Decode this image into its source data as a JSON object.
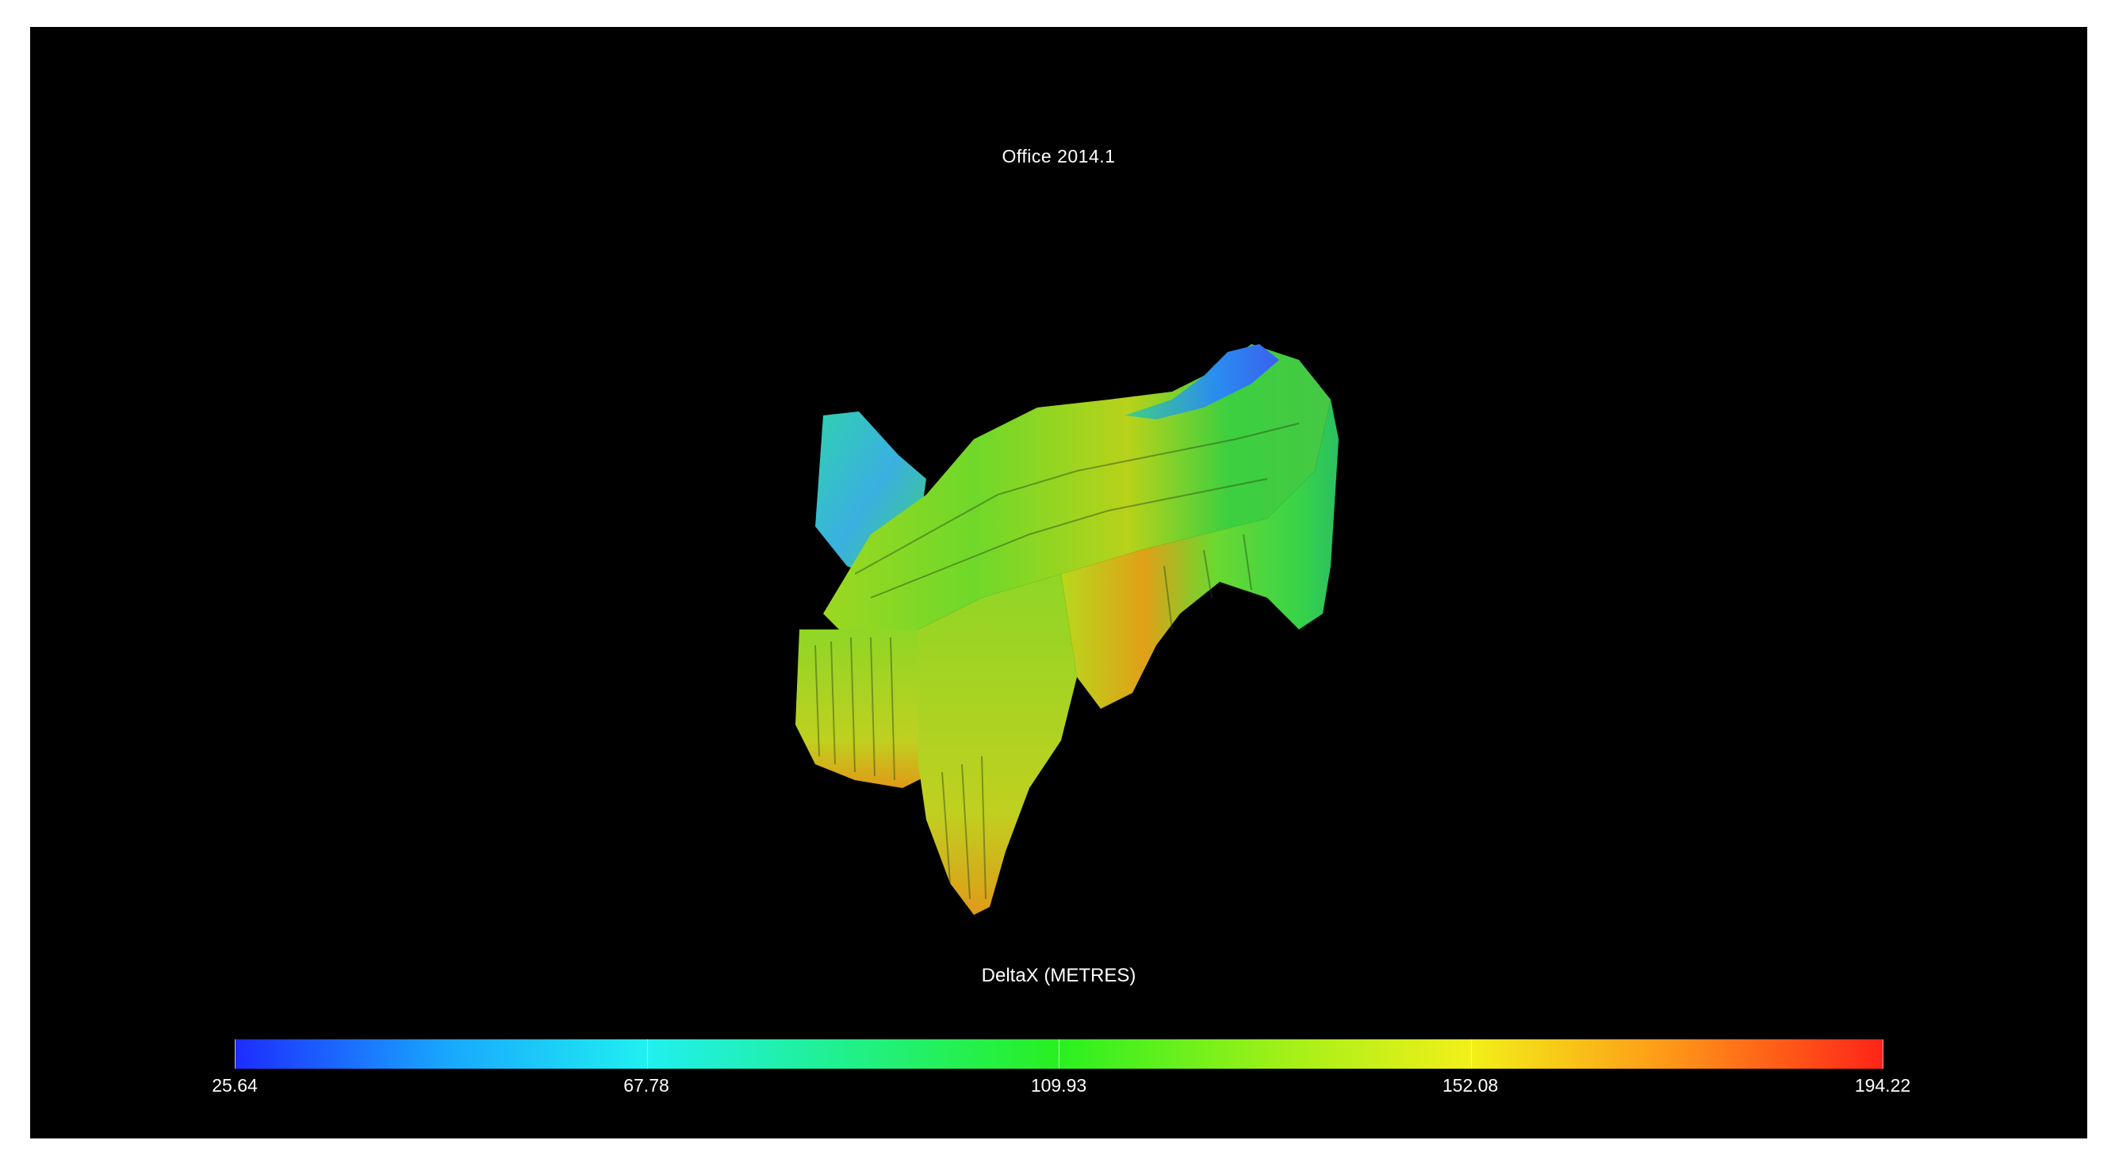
{
  "viewer": {
    "title": "Office 2014.1",
    "property_label": "DeltaX (METRES)"
  },
  "colorbar": {
    "ticks": [
      "25.64",
      "67.78",
      "109.93",
      "152.08",
      "194.22"
    ],
    "colors": [
      "#1e2cff",
      "#20f0f0",
      "#28f020",
      "#f2f018",
      "#ff2418"
    ]
  }
}
